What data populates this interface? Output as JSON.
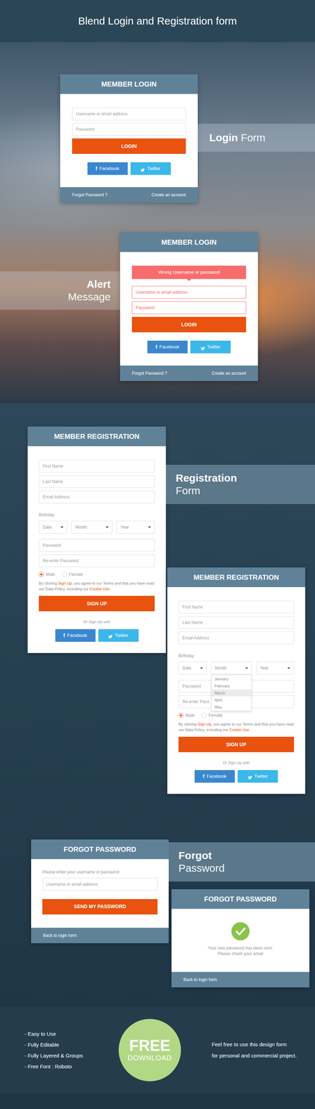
{
  "header": {
    "title": "Blend Login and Registration form"
  },
  "login_form": {
    "title": "MEMBER LOGIN",
    "fields": [
      {
        "placeholder": "Username or email address",
        "error": false
      },
      {
        "placeholder": "Password",
        "error": false
      }
    ],
    "submit": "LOGIN",
    "social": [
      {
        "kind": "facebook",
        "icon": "f",
        "label": "Facebook"
      },
      {
        "kind": "twitter",
        "label": "Twitter"
      }
    ],
    "links": [
      "Forgot Password ?",
      "Create an account"
    ]
  },
  "login_caption": {
    "strong": "Login",
    "light": "Form"
  },
  "alert_form": {
    "title": "MEMBER LOGIN",
    "alert": "Wrong Username or password",
    "fields": [
      {
        "placeholder": "Username or email address",
        "error": true
      },
      {
        "placeholder": "Password",
        "error": true
      }
    ],
    "submit": "LOGIN",
    "social": [
      {
        "kind": "facebook",
        "icon": "f",
        "label": "Facebook"
      },
      {
        "kind": "twitter",
        "label": "Twitter"
      }
    ],
    "links": [
      "Forgot Password ?",
      "Create an account"
    ]
  },
  "alert_caption": {
    "strong": "Alert",
    "light": "Message"
  },
  "registration_caption": {
    "strong": "Registration",
    "light": "Form"
  },
  "registration_forms": [
    {
      "title": "MEMBER REGISTRATION",
      "fields_top": [
        {
          "placeholder": "First Name"
        },
        {
          "placeholder": "Last Name"
        },
        {
          "placeholder": "Email Address"
        }
      ],
      "birthday_label": "Birthday",
      "selects": [
        {
          "label": "Date",
          "open": false
        },
        {
          "label": "Month",
          "open": false
        },
        {
          "label": "Year",
          "open": false
        }
      ],
      "fields_bottom": [
        {
          "placeholder": "Password"
        },
        {
          "placeholder": "Re-enter Password"
        }
      ],
      "gender": [
        {
          "label": "Male",
          "selected": true
        },
        {
          "label": "Female",
          "selected": false
        }
      ],
      "terms": [
        {
          "text": "By clicking ",
          "kind": "text"
        },
        {
          "text": "Sign Up",
          "kind": "link"
        },
        {
          "text": ", you agree to our Terms and that you have read our Data Policy, including our ",
          "kind": "text"
        },
        {
          "text": "Cookie Use",
          "kind": "link"
        },
        {
          "text": ".",
          "kind": "text"
        }
      ],
      "submit": "SIGN UP",
      "alt_label": "Or Sign Up with",
      "social": [
        {
          "kind": "facebook",
          "icon": "f",
          "label": "Facebook"
        },
        {
          "kind": "twitter",
          "label": "Twitter"
        }
      ]
    },
    {
      "title": "MEMBER REGISTRATION",
      "fields_top": [
        {
          "placeholder": "First Name"
        },
        {
          "placeholder": "Last Name"
        },
        {
          "placeholder": "Email Address"
        }
      ],
      "birthday_label": "Birthday",
      "selects": [
        {
          "label": "Date",
          "open": false
        },
        {
          "label": "Month",
          "open": true,
          "options": [
            {
              "label": "January",
              "selected": false
            },
            {
              "label": "February",
              "selected": false
            },
            {
              "label": "March",
              "selected": true
            },
            {
              "label": "April",
              "selected": false
            },
            {
              "label": "May",
              "selected": false
            }
          ]
        },
        {
          "label": "Year",
          "open": false
        }
      ],
      "fields_bottom": [
        {
          "placeholder": "Password"
        },
        {
          "placeholder": "Re-enter Pass"
        }
      ],
      "gender": [
        {
          "label": "Male",
          "selected": true
        },
        {
          "label": "Female",
          "selected": false
        }
      ],
      "terms": [
        {
          "text": "By clicking ",
          "kind": "text"
        },
        {
          "text": "Sign Up",
          "kind": "link"
        },
        {
          "text": ", you agree to our Terms and that you have read our Data Policy, including our ",
          "kind": "text"
        },
        {
          "text": "Cookie Use",
          "kind": "link"
        },
        {
          "text": ".",
          "kind": "text"
        }
      ],
      "submit": "SIGN UP",
      "alt_label": "Or Sign Up with",
      "social": [
        {
          "kind": "facebook",
          "icon": "f",
          "label": "Facebook"
        },
        {
          "kind": "twitter",
          "label": "Twitter"
        }
      ]
    }
  ],
  "forgot_caption": {
    "strong": "Forgot",
    "light": "Password"
  },
  "forgot_request": {
    "title": "FORGOT PASSWORD",
    "prompt": "Please enter your username or password",
    "field": {
      "placeholder": "Username or email address"
    },
    "submit": "SEND MY PASSWORD",
    "back": "Back to login form"
  },
  "forgot_done": {
    "title": "FORGOT PASSWORD",
    "message": [
      "Your new password has been sent.",
      "Please check your email"
    ],
    "back": "Back to login form"
  },
  "footer": {
    "features": [
      "- Easy to Use",
      "- Fully Editable",
      "- Fully Layered & Groups",
      "- Free Font : Roboto"
    ],
    "free": {
      "top": "FREE",
      "bottom": "DOWNLOAD"
    },
    "note": [
      "Feel free to use this design form",
      "for personal and commercial project."
    ]
  }
}
